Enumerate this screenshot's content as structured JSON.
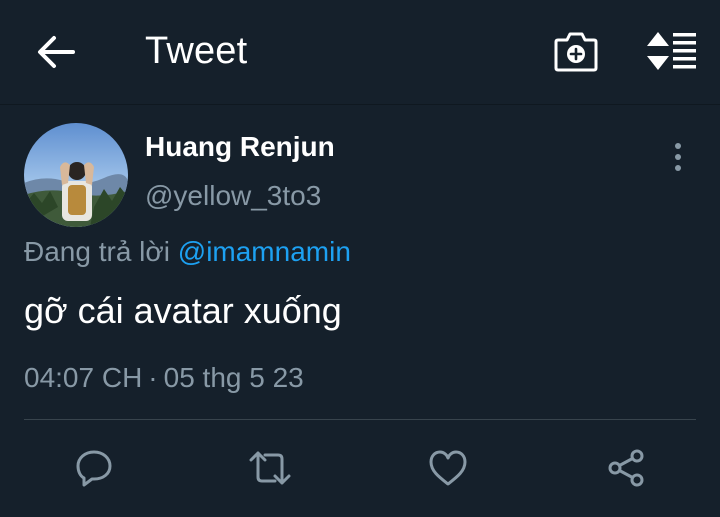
{
  "header": {
    "back_icon": "arrow-left-icon",
    "title": "Tweet",
    "camera_icon": "camera-plus-icon",
    "sort_icon": "sort-list-icon"
  },
  "tweet": {
    "author_name": "Huang Renjun",
    "author_handle": "@yellow_3to3",
    "reply_prefix": "Đang trả lời",
    "reply_to": "@imamnamin",
    "text": "gỡ cái avatar xuống",
    "time": "04:07 CH",
    "separator": "·",
    "date": "05 thg 5 23",
    "more_icon": "more-vertical-icon"
  },
  "actions": {
    "reply_icon": "reply-icon",
    "retweet_icon": "retweet-icon",
    "like_icon": "heart-icon",
    "share_icon": "share-icon"
  },
  "colors": {
    "background": "#15202b",
    "secondary_text": "#8899a6",
    "link": "#1da1f2",
    "divider": "#38444d"
  }
}
